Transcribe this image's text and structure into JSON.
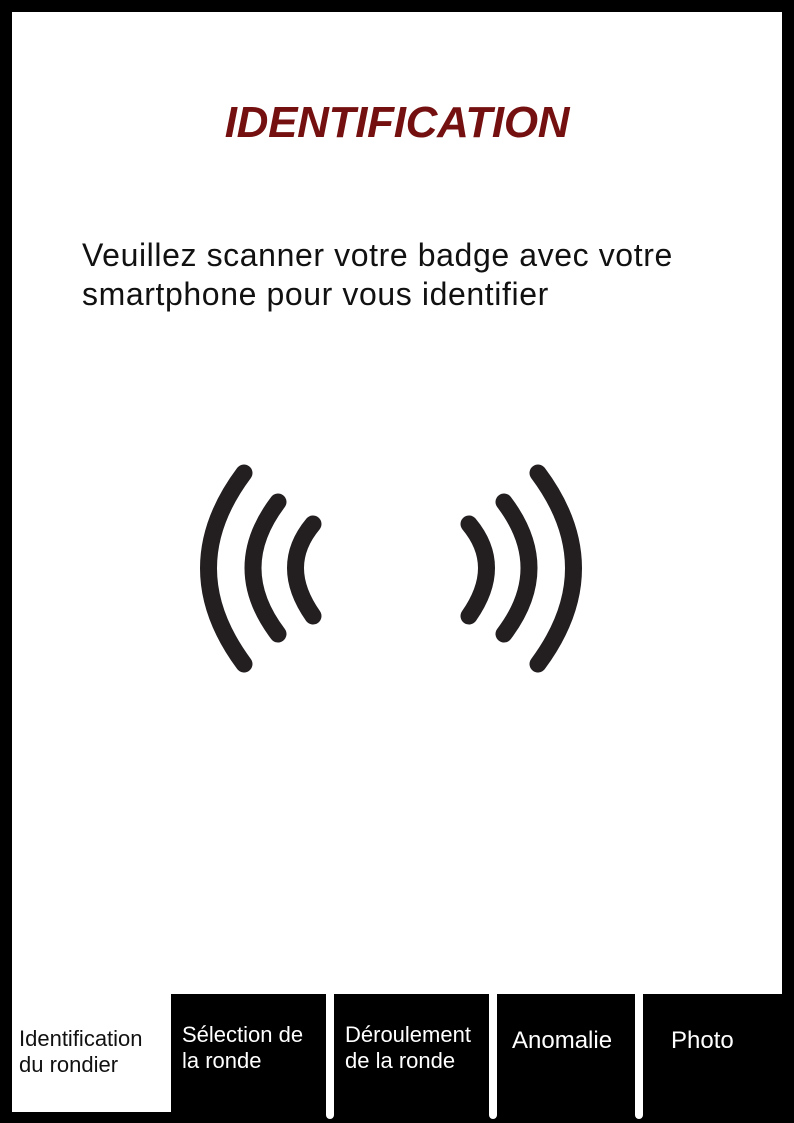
{
  "header": {
    "title": "IDENTIFICATION",
    "title_color": "#751010"
  },
  "main": {
    "instruction_line1": "Veuillez scanner votre badge avec votre",
    "instruction_line2": "smartphone pour vous identifier",
    "icon": "nfc-wave-icon"
  },
  "tabs": [
    {
      "line1": "Identification",
      "line2": "du rondier",
      "active": true
    },
    {
      "line1": "Sélection de",
      "line2": "la ronde",
      "active": false
    },
    {
      "line1": "Déroulement",
      "line2": "de la ronde",
      "active": false
    },
    {
      "line1": "Anomalie",
      "line2": "",
      "active": false
    },
    {
      "line1": "Photo",
      "line2": "",
      "active": false
    }
  ],
  "colors": {
    "frame": "#000000",
    "background": "#ffffff",
    "icon": "#231f20"
  }
}
